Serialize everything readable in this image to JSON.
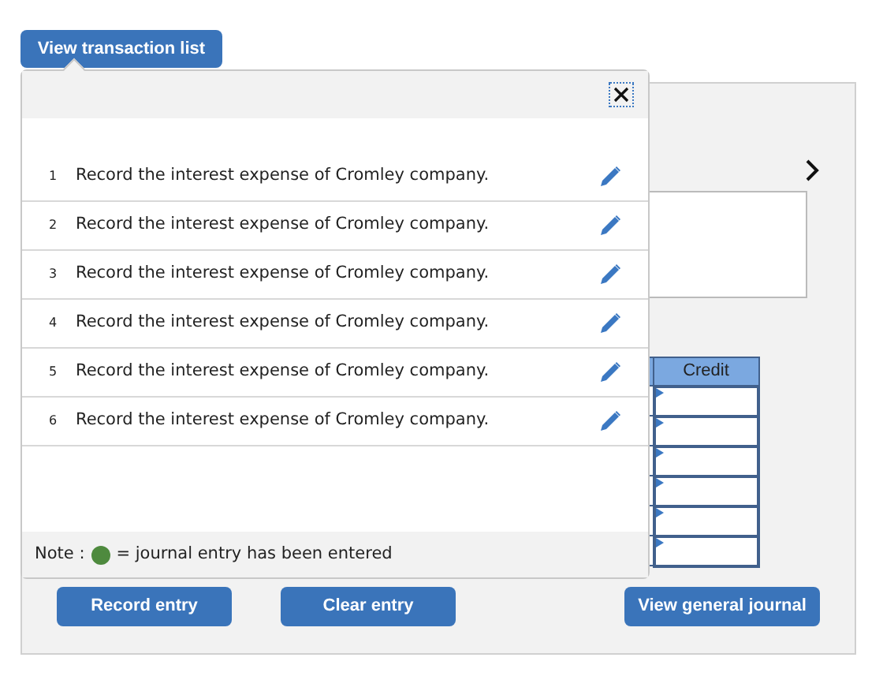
{
  "toggle_button": "View transaction list",
  "transactions": [
    {
      "number": "1",
      "text": "Record the interest expense of Cromley company."
    },
    {
      "number": "2",
      "text": "Record the interest expense of Cromley company."
    },
    {
      "number": "3",
      "text": "Record the interest expense of Cromley company."
    },
    {
      "number": "4",
      "text": "Record the interest expense of Cromley company."
    },
    {
      "number": "5",
      "text": "Record the interest expense of Cromley company."
    },
    {
      "number": "6",
      "text": "Record the interest expense of Cromley company."
    }
  ],
  "note": {
    "label": "Note :",
    "text": "= journal entry has been entered",
    "color": "#4e8a3e"
  },
  "journal_table": {
    "columns": [
      "Credit"
    ]
  },
  "buttons": [
    "Record entry",
    "Clear entry",
    "View general journal"
  ]
}
